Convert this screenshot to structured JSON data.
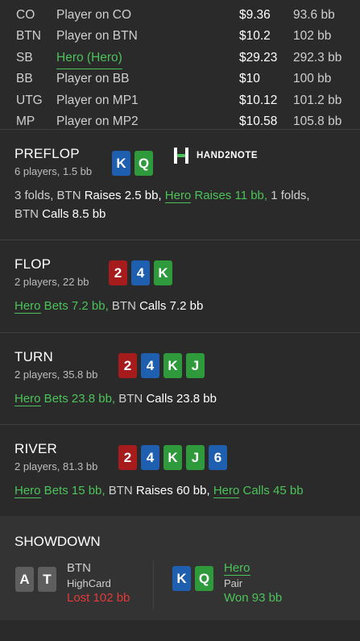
{
  "players": [
    {
      "pos": "CO",
      "name": "Player on CO",
      "stack": "$9.36",
      "bb": "93.6 bb",
      "hero": false
    },
    {
      "pos": "BTN",
      "name": "Player on BTN",
      "stack": "$10.2",
      "bb": "102 bb",
      "hero": false
    },
    {
      "pos": "SB",
      "name": "Hero (Hero)",
      "stack": "$29.23",
      "bb": "292.3 bb",
      "hero": true
    },
    {
      "pos": "BB",
      "name": "Player on BB",
      "stack": "$10",
      "bb": "100 bb",
      "hero": false
    },
    {
      "pos": "UTG",
      "name": "Player on MP1",
      "stack": "$10.12",
      "bb": "101.2 bb",
      "hero": false
    },
    {
      "pos": "MP",
      "name": "Player on MP2",
      "stack": "$10.58",
      "bb": "105.8 bb",
      "hero": false
    }
  ],
  "logo_text": "HAND2NOTE",
  "preflop": {
    "name": "PREFLOP",
    "sub": "6 players, 1.5 bb",
    "cards": [
      {
        "rank": "K",
        "color": "blue"
      },
      {
        "rank": "Q",
        "color": "green"
      }
    ],
    "actions": {
      "a1": "3 folds, BTN ",
      "a2": "Raises 2.5 bb,",
      "a3": "Hero",
      "a4": " Raises 11 bb,",
      "a5": " 1 folds,",
      "a6": "BTN ",
      "a7": "Calls 8.5 bb"
    }
  },
  "flop": {
    "name": "FLOP",
    "sub": "2 players, 22 bb",
    "cards": [
      {
        "rank": "2",
        "color": "red"
      },
      {
        "rank": "4",
        "color": "blue"
      },
      {
        "rank": "K",
        "color": "green"
      }
    ],
    "actions": {
      "a1": "Hero",
      "a2": " Bets 7.2 bb,",
      "a3": " BTN ",
      "a4": "Calls 7.2 bb"
    }
  },
  "turn": {
    "name": "TURN",
    "sub": "2 players, 35.8 bb",
    "cards": [
      {
        "rank": "2",
        "color": "red"
      },
      {
        "rank": "4",
        "color": "blue"
      },
      {
        "rank": "K",
        "color": "green"
      },
      {
        "rank": "J",
        "color": "green"
      }
    ],
    "actions": {
      "a1": "Hero",
      "a2": " Bets 23.8 bb,",
      "a3": " BTN ",
      "a4": "Calls 23.8 bb"
    }
  },
  "river": {
    "name": "RIVER",
    "sub": "2 players, 81.3 bb",
    "cards": [
      {
        "rank": "2",
        "color": "red"
      },
      {
        "rank": "4",
        "color": "blue"
      },
      {
        "rank": "K",
        "color": "green"
      },
      {
        "rank": "J",
        "color": "green"
      },
      {
        "rank": "6",
        "color": "blue"
      }
    ],
    "actions": {
      "a1": "Hero",
      "a2": " Bets 15 bb,",
      "a3": " BTN ",
      "a4": "Raises 60 bb,",
      "a5": "Hero",
      "a6": " Calls 45 bb"
    }
  },
  "showdown": {
    "title": "SHOWDOWN",
    "left": {
      "cards": [
        {
          "rank": "A",
          "color": "grey"
        },
        {
          "rank": "T",
          "color": "grey"
        }
      ],
      "name": "BTN",
      "hand": "HighCard",
      "result": "Lost 102 bb"
    },
    "right": {
      "cards": [
        {
          "rank": "K",
          "color": "blue"
        },
        {
          "rank": "Q",
          "color": "green"
        }
      ],
      "name": "Hero",
      "hand": "Pair",
      "result": "Won 93 bb"
    }
  },
  "colors": {
    "bg": "#2a2a2a",
    "showdown_bg": "#333333",
    "red_card": "#a61b1b",
    "blue_card": "#1f5fb0",
    "green_card": "#2f9a3b",
    "grey_card": "#5e5e5e",
    "hero_green": "#4cc35a",
    "lost_red": "#e43a3a"
  }
}
